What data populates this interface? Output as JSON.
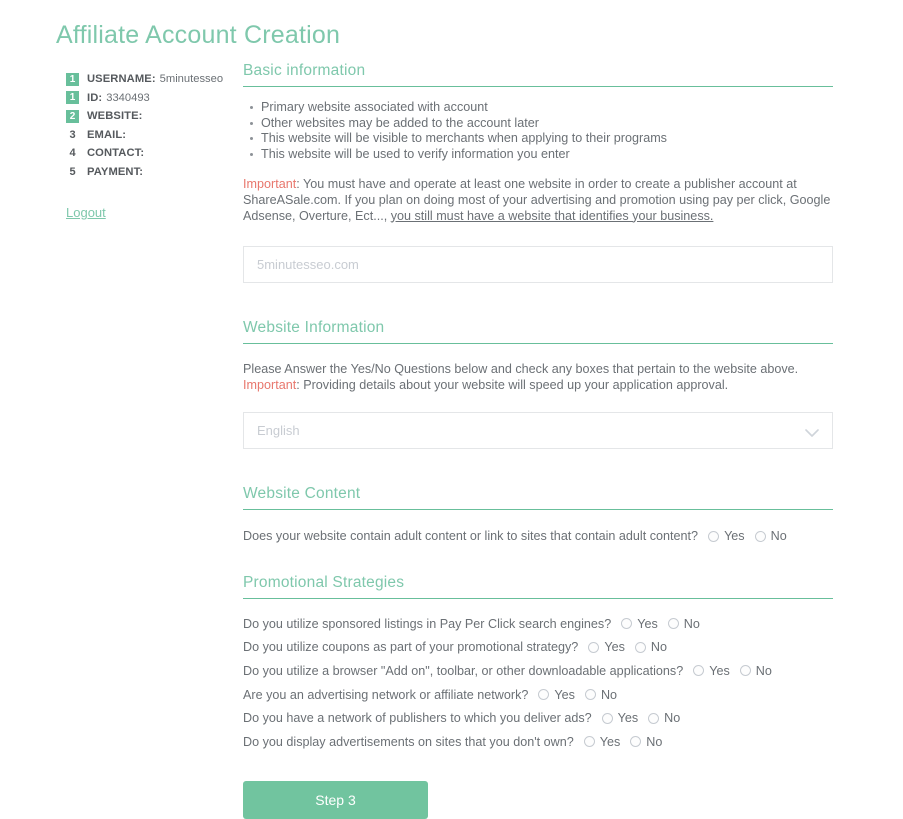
{
  "page": {
    "title": "Affiliate Account Creation",
    "accent_green": "#7fc8ac",
    "badge_green": "#68bf9b",
    "button_green": "#71c49f",
    "important_red": "#e8776d"
  },
  "sidebar": {
    "steps": [
      {
        "number": "1",
        "badge": true,
        "label": "USERNAME:",
        "value": "5minutesseo"
      },
      {
        "number": "1",
        "badge": true,
        "label": "ID:",
        "value": "3340493"
      },
      {
        "number": "2",
        "badge": true,
        "label": "WEBSITE:",
        "value": ""
      },
      {
        "number": "3",
        "badge": false,
        "label": "EMAIL:",
        "value": ""
      },
      {
        "number": "4",
        "badge": false,
        "label": "CONTACT:",
        "value": ""
      },
      {
        "number": "5",
        "badge": false,
        "label": "PAYMENT:",
        "value": ""
      }
    ],
    "logout_label": "Logout"
  },
  "basic_information": {
    "heading": "Basic information",
    "bullets": [
      "Primary website associated with account",
      "Other websites may be added to the account later",
      "This website will be visible to merchants when applying to their programs",
      "This website will be used to verify information you enter"
    ],
    "important_label": "Important",
    "notice_part1": ": You must have and operate at least one website in order to create a publisher account at ShareASale.com. If you plan on doing most of your advertising and promotion using pay per click, Google Adsense, Overture, Ect..., ",
    "notice_underlined": "you still must have a website that identifies your business.",
    "website_input_value": "",
    "website_input_placeholder": "5minutesseo.com"
  },
  "website_information": {
    "heading": "Website Information",
    "intro": "Please Answer the Yes/No Questions below and check any boxes that pertain to the website above.",
    "important_label": "Important",
    "important_text": ": Providing details about your website will speed up your application approval.",
    "language_selected": "English",
    "language_options": [
      "English"
    ],
    "chevron_icon": "chevron-down-icon"
  },
  "website_content": {
    "heading": "Website Content",
    "questions": [
      {
        "text": "Does your website contain adult content or link to sites that contain adult content?",
        "options": [
          "Yes",
          "No"
        ],
        "selected": null
      }
    ]
  },
  "promotional_strategies": {
    "heading": "Promotional Strategies",
    "questions": [
      {
        "text": "Do you utilize sponsored listings in Pay Per Click search engines?",
        "options": [
          "Yes",
          "No"
        ],
        "selected": null
      },
      {
        "text": "Do you utilize coupons as part of your promotional strategy?",
        "options": [
          "Yes",
          "No"
        ],
        "selected": null
      },
      {
        "text": "Do you utilize a browser \"Add on\", toolbar, or other downloadable applications?",
        "options": [
          "Yes",
          "No"
        ],
        "selected": null
      },
      {
        "text": "Are you an advertising network or affiliate network?",
        "options": [
          "Yes",
          "No"
        ],
        "selected": null
      },
      {
        "text": "Do you have a network of publishers to which you deliver ads?",
        "options": [
          "Yes",
          "No"
        ],
        "selected": null
      },
      {
        "text": "Do you display advertisements on sites that you don't own?",
        "options": [
          "Yes",
          "No"
        ],
        "selected": null
      }
    ]
  },
  "footer": {
    "submit_label": "Step 3"
  }
}
